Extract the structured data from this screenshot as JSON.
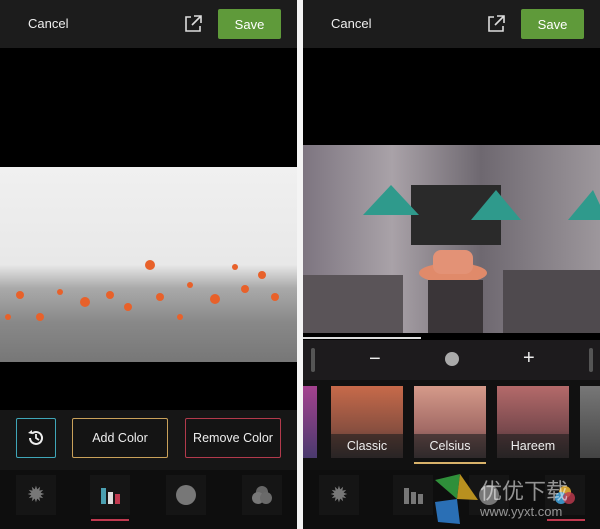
{
  "left_screen": {
    "topbar": {
      "cancel_label": "Cancel",
      "share_icon": "share-icon",
      "save_label": "Save",
      "save_color": "#5f9a3a"
    },
    "toolbar": {
      "history_icon": "history-icon",
      "add_color_label": "Add Color",
      "remove_color_label": "Remove Color",
      "add_color_border": "#c9a15a",
      "remove_color_border": "#b23a4c",
      "history_border": "#3fa6b8"
    },
    "tabs": [
      {
        "icon": "sun-icon"
      },
      {
        "icon": "color-bottles-icon",
        "active": true
      },
      {
        "icon": "face-icon"
      },
      {
        "icon": "overlap-circles-icon"
      }
    ]
  },
  "right_screen": {
    "topbar": {
      "cancel_label": "Cancel",
      "save_label": "Save"
    },
    "slider": {
      "minus_label": "−",
      "plus_label": "+"
    },
    "filters": [
      {
        "label": "Classic"
      },
      {
        "label": "Celsius",
        "selected": true
      },
      {
        "label": "Hareem"
      }
    ],
    "tabs": [
      {
        "icon": "sun-icon"
      },
      {
        "icon": "color-bottles-icon"
      },
      {
        "icon": "face-icon"
      },
      {
        "icon": "overlap-circles-icon",
        "active": true
      }
    ]
  },
  "watermark": {
    "text": "优优下载",
    "url": "www.yyxt.com"
  }
}
